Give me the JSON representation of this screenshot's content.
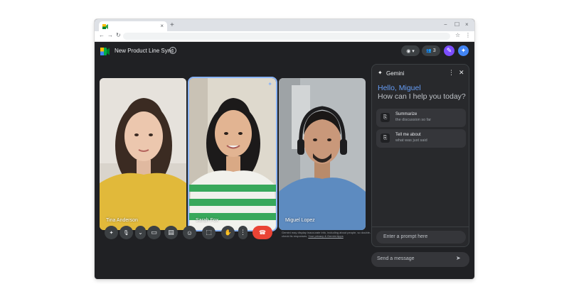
{
  "browser": {
    "tab_title": "",
    "close_glyph": "×",
    "newtab_glyph": "+",
    "window_controls": [
      "−",
      "☐",
      "×"
    ],
    "nav_glyphs": [
      "←",
      "→",
      "↻"
    ],
    "toolbar_right": [
      "☆",
      "⋮"
    ]
  },
  "meeting": {
    "title": "New Product Line Sync",
    "info_glyph": "i",
    "people_count": "3",
    "header_icons": [
      "record-icon",
      "people-icon",
      "gemini-wand-icon",
      "gemini-star-icon"
    ],
    "header_glyphs": {
      "record": "◉ ▾",
      "people": "👥",
      "wand": "✎",
      "star": "✦"
    }
  },
  "participants": [
    {
      "name": "Tina Anderson",
      "active": false
    },
    {
      "name": "Sarah Fox",
      "active": true
    },
    {
      "name": "Miguel Lopez",
      "active": false
    }
  ],
  "controls": {
    "glyphs": [
      "✦",
      "🎙",
      "⌄",
      "▭",
      "▤",
      "☺",
      "⬚",
      "✋",
      "⋮",
      "☎"
    ],
    "icons": [
      "effects-icon",
      "microphone-icon",
      "more-options-icon",
      "camera-icon",
      "captions-icon",
      "emoji-icon",
      "present-icon",
      "raise-hand-icon",
      "more-icon",
      "end-call-icon"
    ]
  },
  "gemini_panel": {
    "title": "Gemini",
    "star_glyph": "✦",
    "more_glyph": "⋮",
    "close_glyph": "✕",
    "greeting": "Hello, Miguel",
    "question": "How can I help you today?",
    "suggestions": [
      {
        "title": "Summarize",
        "subtitle": "the discussion so far",
        "icon_glyph": "⎘"
      },
      {
        "title": "Tell me about",
        "subtitle": "what was just said",
        "icon_glyph": "⎘"
      }
    ],
    "prompt_placeholder": "Enter a prompt here",
    "disclaimer_text": "Gemini may display inaccurate info, including about people, so double-check its responses. ",
    "disclaimer_link": "Your privacy & Gemini Apps"
  },
  "chat": {
    "placeholder": "Send a message",
    "send_glyph": "➤"
  },
  "colors": {
    "app_background": "#202124",
    "panel_background": "#28292c",
    "accent_blue": "#669df6",
    "active_outline": "#8ab4f8",
    "end_call_red": "#ea4335",
    "gemini_button": "#4285f4",
    "wand_button": "#7c4dff"
  }
}
